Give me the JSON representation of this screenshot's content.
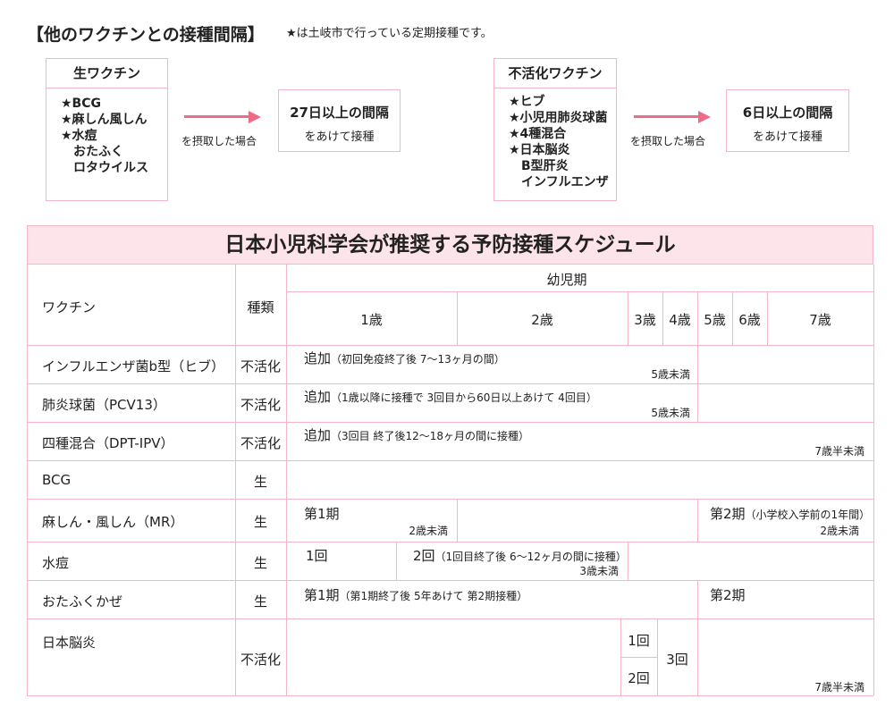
{
  "header": {
    "title": "【他のワクチンとの接種間隔】",
    "note": "★は土岐市で行っている定期接種です。"
  },
  "live_panel": {
    "heading": "生ワクチン",
    "items": [
      "★BCG",
      "★麻しん風しん",
      "★水痘",
      "おたふく",
      "ロタウイルス"
    ],
    "arrow_label": "を摂取した場合",
    "interval_big": "27日以上の間隔",
    "interval_small": "をあけて接種"
  },
  "inactive_panel": {
    "heading": "不活化ワクチン",
    "items": [
      "★ヒブ",
      "★小児用肺炎球菌",
      "★4種混合",
      "★日本脳炎",
      "B型肝炎",
      "インフルエンザ"
    ],
    "arrow_label": "を摂取した場合",
    "interval_big": "6日以上の間隔",
    "interval_small": "をあけて接種"
  },
  "schedule": {
    "title": "日本小児科学会が推奨する予防接種スケジュール",
    "col_vaccine": "ワクチン",
    "col_type": "種類",
    "period": "幼児期",
    "ages": [
      "1歳",
      "2歳",
      "3歳",
      "4歳",
      "5歳",
      "6歳",
      "7歳"
    ],
    "rows": [
      {
        "name": "インフルエンザ菌b型（ヒブ）",
        "type": "不活化",
        "main": "追加",
        "sub": "（初回免疫終了後 7〜13ヶ月の間）",
        "limit": "5歳未満"
      },
      {
        "name": "肺炎球菌（PCV13）",
        "type": "不活化",
        "main": "追加",
        "sub": "（1歳以降に接種で 3回目から60日以上あけて 4回目）",
        "limit": "5歳未満"
      },
      {
        "name": "四種混合（DPT-IPV）",
        "type": "不活化",
        "main": "追加",
        "sub": "（3回目 終了後12〜18ヶ月の間に接種）",
        "limit": "7歳半未満"
      },
      {
        "name": "BCG",
        "type": "生"
      },
      {
        "name": "麻しん・風しん（MR）",
        "type": "生",
        "p1": "第1期",
        "p1_limit": "2歳未満",
        "p2": "第2期",
        "p2_sub": "（小学校入学前の1年間）",
        "p2_limit": "2歳未満"
      },
      {
        "name": "水痘",
        "type": "生",
        "d1": "1回",
        "d2": "2回",
        "d2_sub": "（1回目終了後 6〜12ヶ月の間に接種）",
        "d2_limit": "3歳未満"
      },
      {
        "name": "おたふくかぜ",
        "type": "生",
        "p1": "第1期",
        "p1_sub": "（第1期終了後 5年あけて 第2期接種）",
        "p2": "第2期"
      },
      {
        "name": "日本脳炎",
        "type": "不活化",
        "d1": "1回",
        "d2": "2回",
        "d3": "3回",
        "limit": "7歳半未満"
      }
    ]
  }
}
